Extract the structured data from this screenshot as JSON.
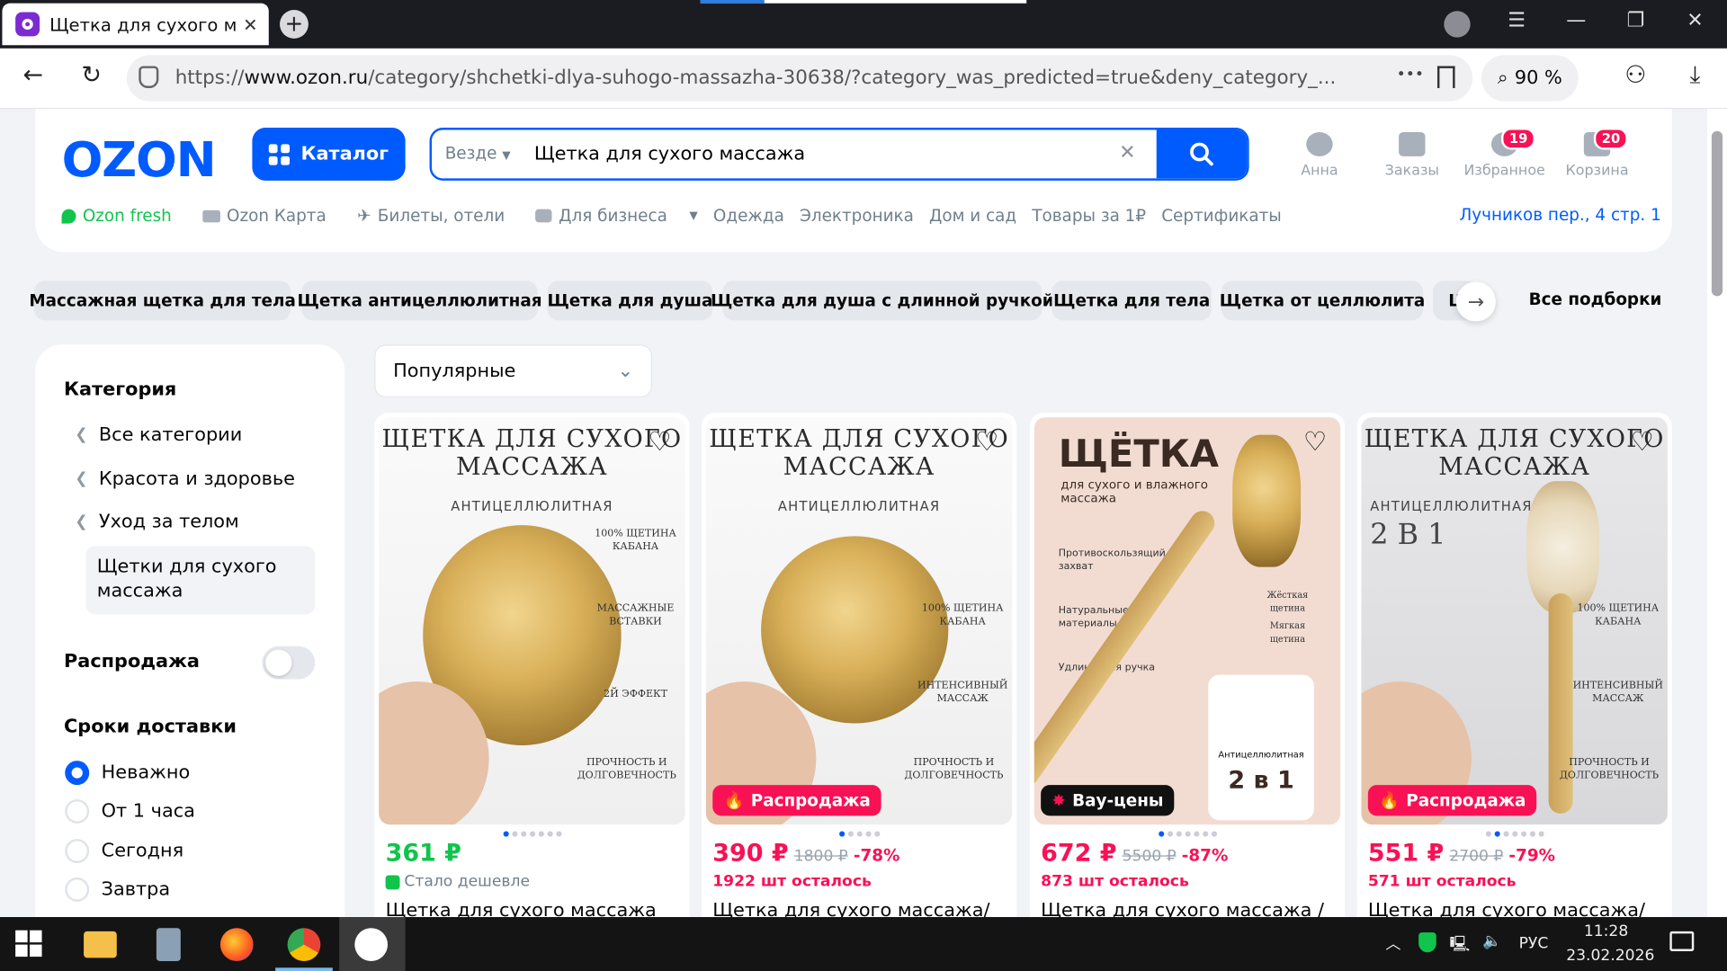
{
  "browser": {
    "tab_title": "Щетка для сухого масс",
    "tab_close": "✕",
    "new_tab": "+",
    "url_prefix": "https://",
    "url_domain": "www.ozon.ru",
    "url_rest": "/category/shchetki-dlya-suhogo-massazha-30638/?category_was_predicted=true&deny_category_...",
    "zoom": "90 %",
    "more_icon": "•••"
  },
  "header": {
    "logo": "OZON",
    "catalog_label": "Каталог",
    "search_scope": "Везде",
    "search_value": "Щетка для сухого массажа",
    "user_label": "Анна",
    "orders_label": "Заказы",
    "favorites_label": "Избранное",
    "favorites_count": "19",
    "cart_label": "Корзина",
    "cart_count": "20",
    "address": "Лучников пер., 4 стр. 1"
  },
  "menu": [
    "Ozon fresh",
    "Ozon Карта",
    "Билеты, отели",
    "Для бизнеса",
    "Одежда",
    "Электроника",
    "Дом и сад",
    "Товары за 1₽",
    "Сертификаты"
  ],
  "chips": [
    "Массажная щетка для тела",
    "Щетка антицеллюлитная",
    "Щетка для душа",
    "Щетка для душа с длинной ручкой",
    "Щетка для тела",
    "Щетка от целлюлита",
    "Щ"
  ],
  "all_selections": "Все подборки",
  "sidebar": {
    "category_heading": "Категория",
    "categories": [
      "Все категории",
      "Красота и здоровье",
      "Уход за телом"
    ],
    "selected_category": "Щетки для сухого массажа",
    "sale_label": "Распродажа",
    "delivery_heading": "Сроки доставки",
    "delivery_options": [
      "Неважно",
      "От 1 часа",
      "Сегодня",
      "Завтра"
    ],
    "delivery_selected": "Неважно"
  },
  "sort": {
    "value": "Популярные"
  },
  "products": [
    {
      "img_title": "ЩЕТКА ДЛЯ СУХОГО МАССАЖА",
      "img_sub": "АНТИЦЕЛЛЮЛИТНАЯ",
      "notes": [
        "100% ЩЕТИНА КАБАНА",
        "МАССАЖНЫЕ ВСТАВКИ",
        "2Й ЭФФЕКТ",
        "ПРОЧНОСТЬ И ДОЛГОВЕЧНОСТЬ"
      ],
      "label": "",
      "price": "361 ₽",
      "old_price": "",
      "discount": "",
      "sub": "Стало дешевле",
      "name": "Щетка для сухого массажа"
    },
    {
      "img_title": "ЩЕТКА ДЛЯ СУХОГО МАССАЖА",
      "img_sub": "АНТИЦЕЛЛЮЛИТНАЯ",
      "notes": [
        "100% ЩЕТИНА КАБАНА",
        "ИНТЕНСИВНЫЙ МАССАЖ",
        "ПРОЧНОСТЬ И ДОЛГОВЕЧНОСТЬ"
      ],
      "label": "Распродажа",
      "price": "390 ₽",
      "old_price": "1800 ₽",
      "discount": "-78%",
      "sub": "1922 шт осталось",
      "name": "Щетка для сухого массажа/"
    },
    {
      "img_title": "ЩЁТКА",
      "img_sub": "для сухого и влажного массажа",
      "notes": [
        "Противоскользящий захват",
        "Натуральные материалы",
        "Удлинённая ручка",
        "Жёсткая щетина",
        "Мягкая щетина",
        "Антицеллюлитная",
        "2 в 1"
      ],
      "label": "Вау-цены",
      "price": "672 ₽",
      "old_price": "5500 ₽",
      "discount": "-87%",
      "sub": "873 шт осталось",
      "name": "Щетка для сухого массажа /"
    },
    {
      "img_title": "ЩЕТКА ДЛЯ СУХОГО МАССАЖА",
      "img_sub": "АНТИЦЕЛЛЮЛИТНАЯ",
      "notes": [
        "2 В 1",
        "100% ЩЕТИНА КАБАНА",
        "ИНТЕНСИВНЫЙ МАССАЖ",
        "ПРОЧНОСТЬ И ДОЛГОВЕЧНОСТЬ"
      ],
      "label": "Распродажа",
      "price": "551 ₽",
      "old_price": "2700 ₽",
      "discount": "-79%",
      "sub": "571 шт осталось",
      "name": "Щетка для сухого массажа/"
    }
  ],
  "taskbar": {
    "lang": "РУС",
    "time": "11:28",
    "date": "23.02.2026"
  },
  "colors": {
    "brand": "#005bff",
    "sale": "#f91155",
    "green": "#10c44c",
    "wow": "#111111"
  }
}
